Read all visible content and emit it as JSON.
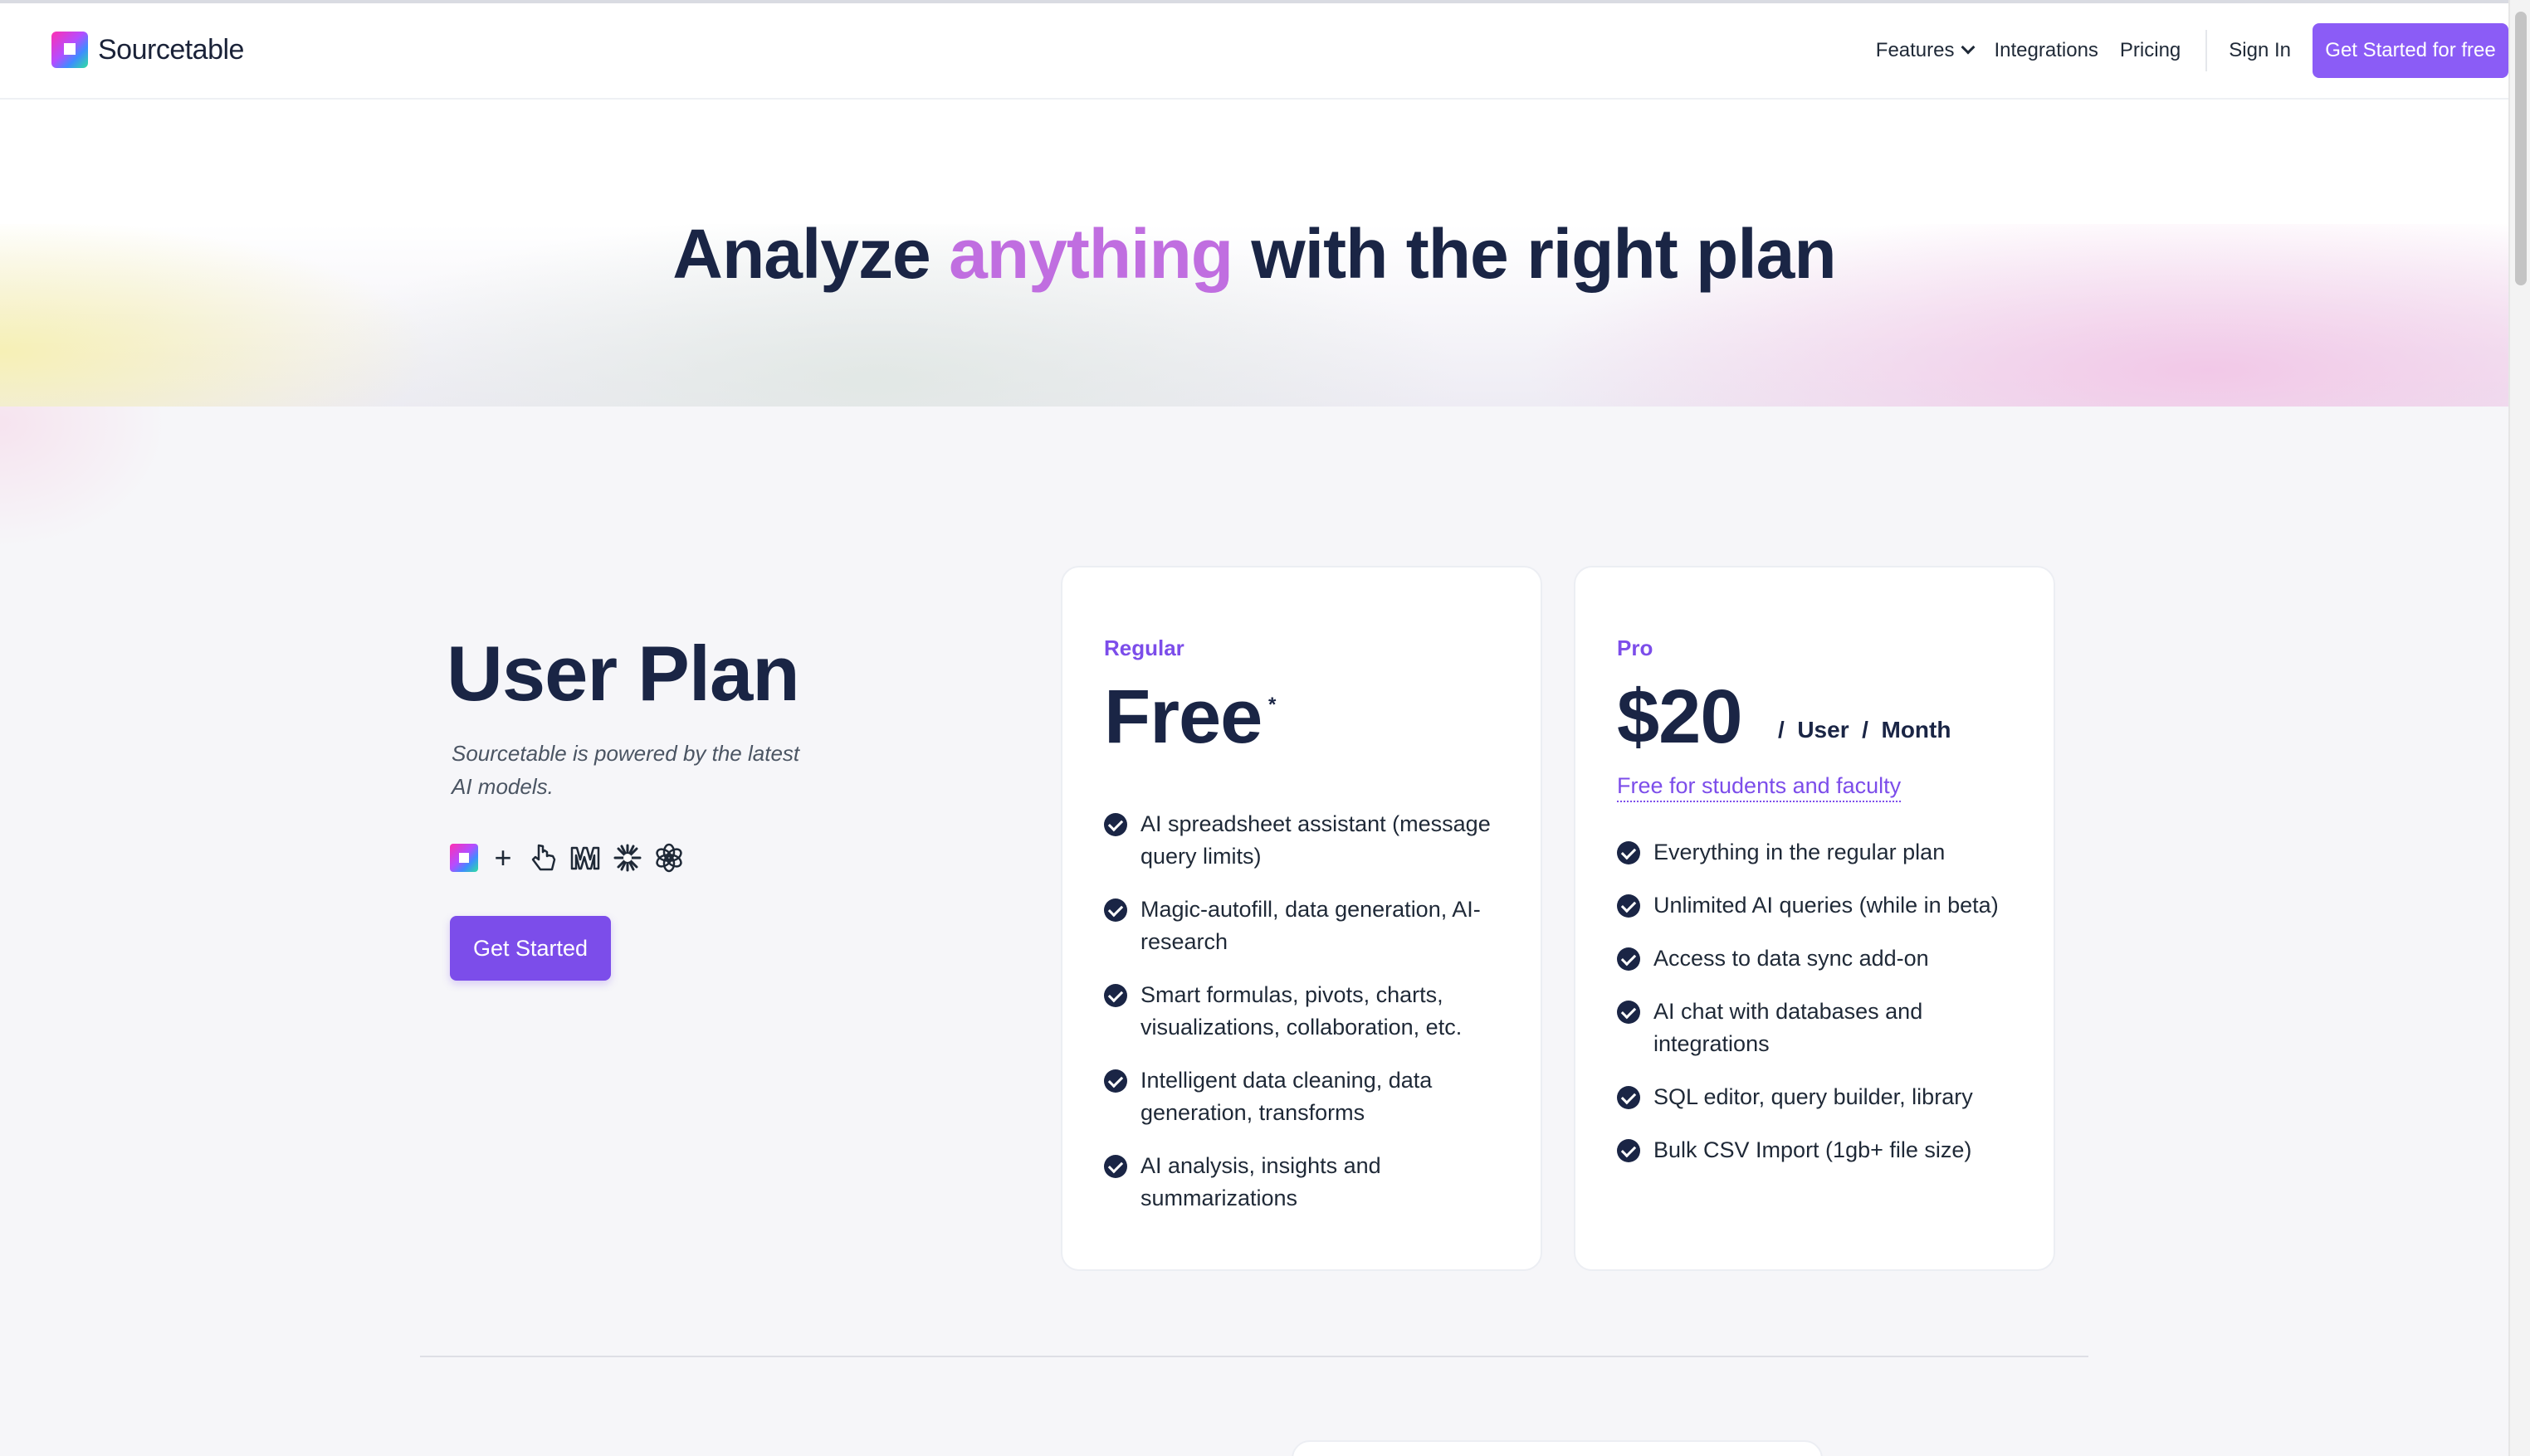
{
  "nav": {
    "logo_text": "Sourcetable",
    "features_label": "Features",
    "integrations_label": "Integrations",
    "pricing_label": "Pricing",
    "sign_in_label": "Sign In",
    "cta_label": "Get Started for free"
  },
  "hero": {
    "title_before": "Analyze ",
    "title_accent": "anything",
    "title_after": " with the right plan",
    "accent_color": "#c06ee0"
  },
  "user_plan": {
    "title": "User Plan",
    "subtitle": "Sourcetable is powered by the latest AI models.",
    "model_icons": [
      "sourcetable-logo-icon",
      "plus-icon",
      "pointer-icon",
      "mistral-icon",
      "claude-icon",
      "openai-icon"
    ],
    "cta_label": "Get Started"
  },
  "plans": {
    "regular": {
      "tier": "Regular",
      "price": "Free",
      "price_note": "*",
      "features": [
        "AI spreadsheet assistant (message query limits)",
        "Magic-autofill, data generation, AI-research",
        "Smart formulas, pivots, charts, visualizations, collaboration, etc.",
        "Intelligent data cleaning, data generation, transforms",
        "AI analysis, insights and summarizations"
      ]
    },
    "pro": {
      "tier": "Pro",
      "price": "$20",
      "price_unit": "/  User  /  Month",
      "student_link": "Free for students and faculty",
      "features": [
        "Everything in the regular plan",
        "Unlimited AI queries (while in beta)",
        "Access to data sync add-on",
        "AI chat with databases and integrations",
        "SQL editor, query builder, library",
        "Bulk CSV Import (1gb+ file size)"
      ]
    }
  },
  "colors": {
    "brand_purple": "#7c4dea",
    "heading": "#1a2545",
    "nav_cta": "#8b5cf6"
  }
}
